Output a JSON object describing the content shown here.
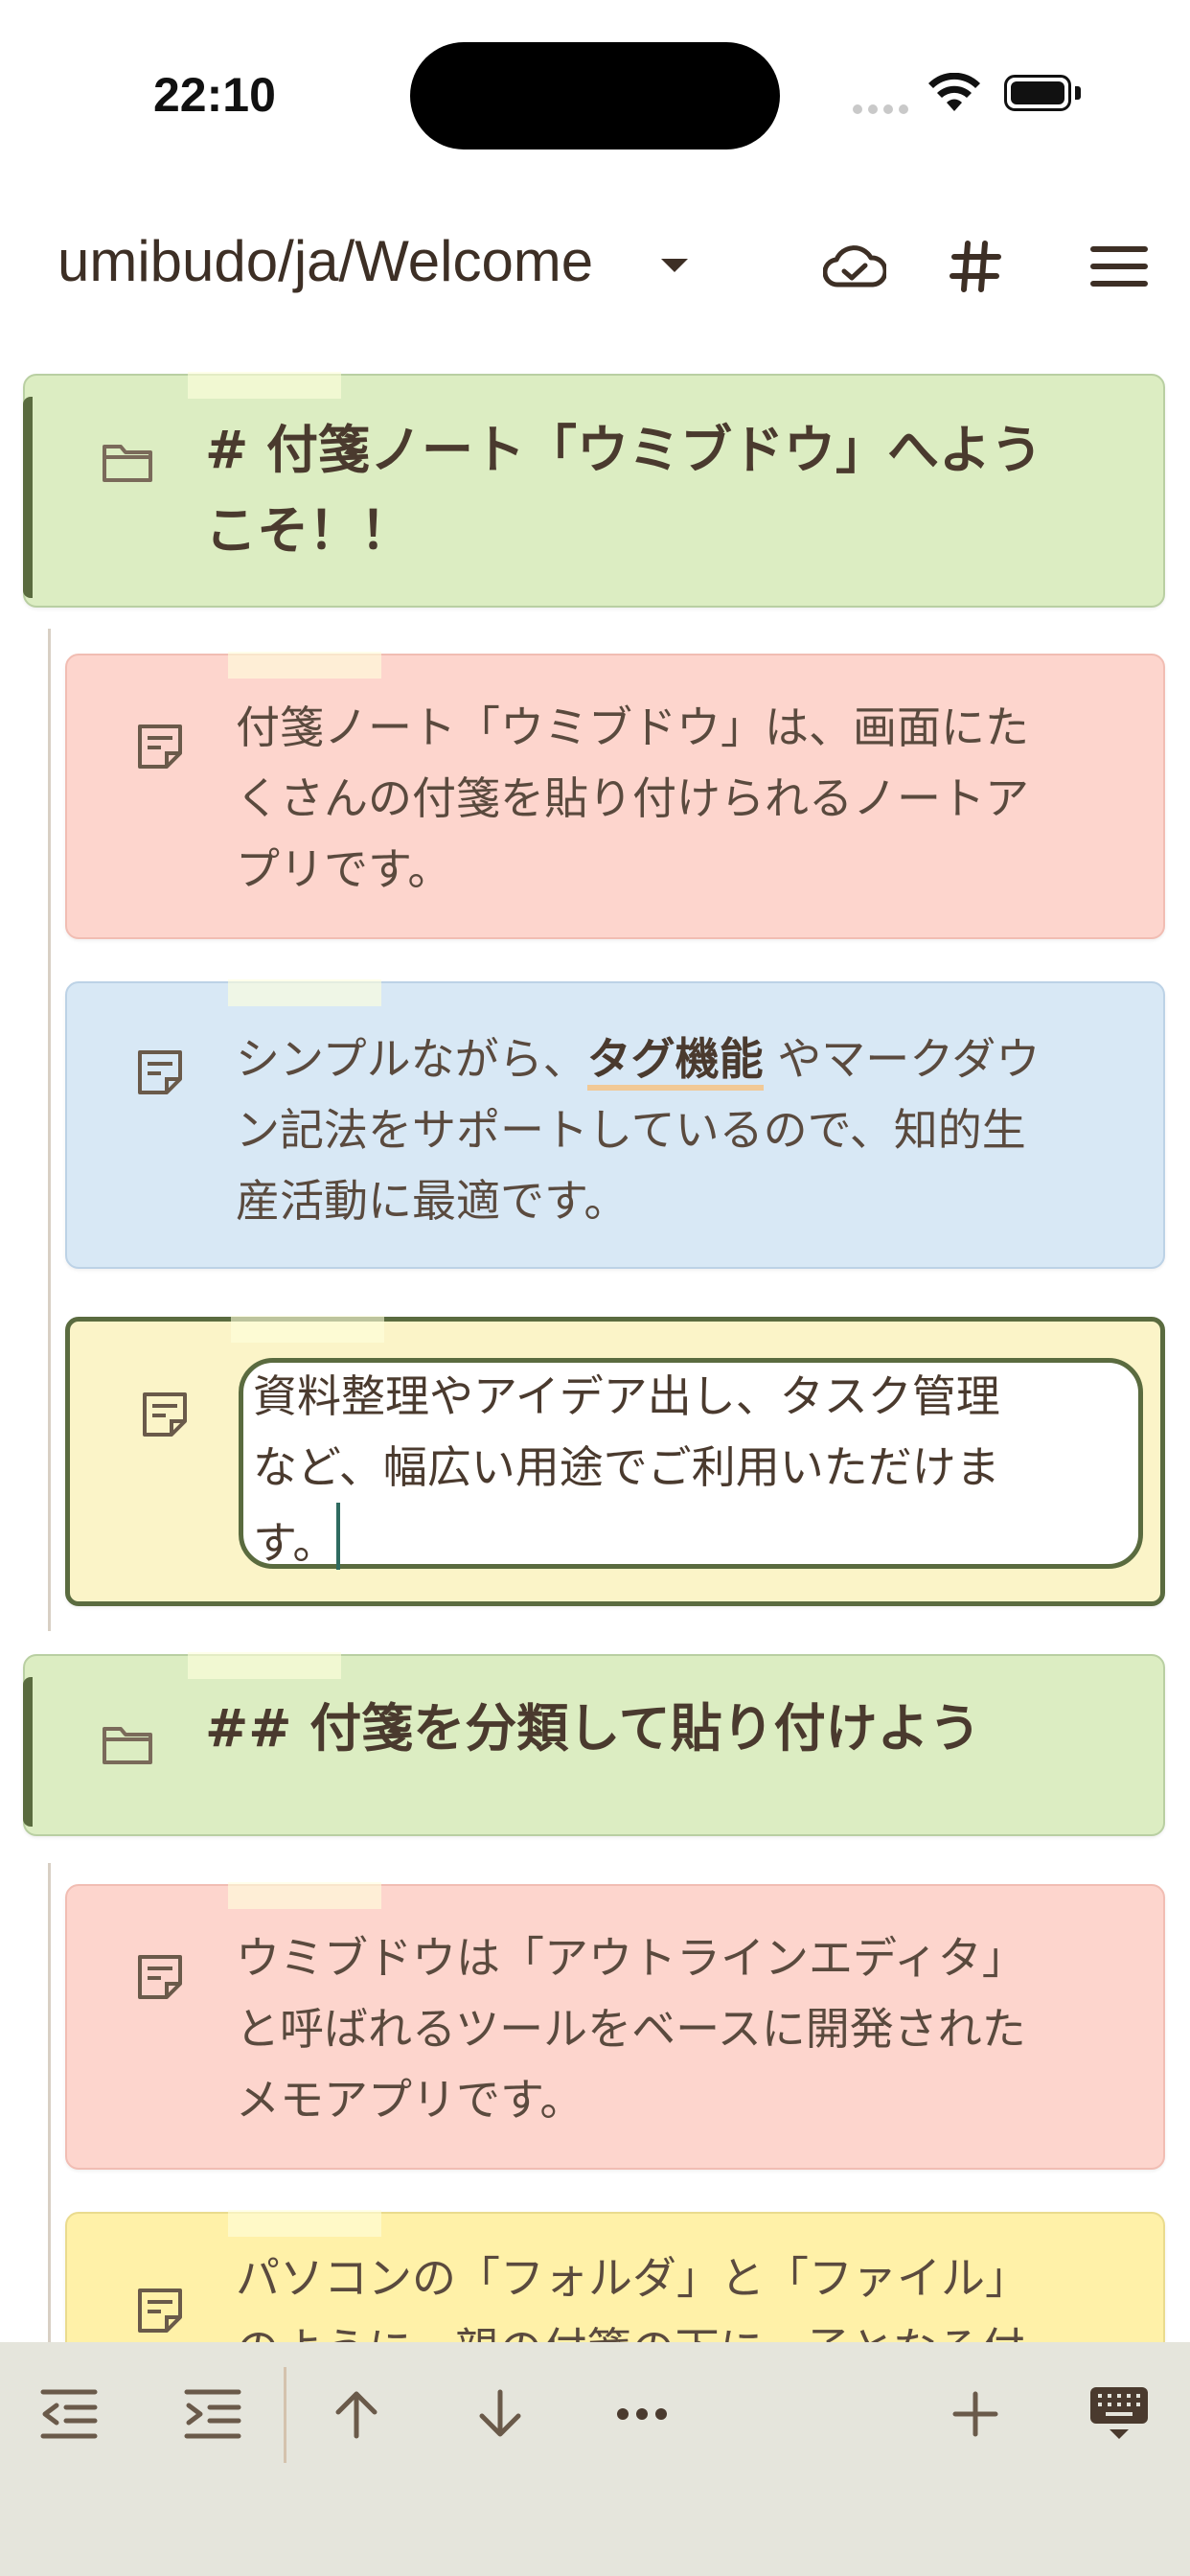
{
  "status_bar": {
    "time": "22:10"
  },
  "header": {
    "title": "umibudo/ja/Welcome"
  },
  "notes": [
    {
      "type": "folder",
      "text": "# 付箋ノート「ウミブドウ」へようこそ！！",
      "lines": [
        "# 付箋ノート「ウミブドウ」へよう",
        "こそ！！"
      ]
    },
    {
      "type": "note",
      "color": "#fdd5cd",
      "lines": [
        "付箋ノート「ウミブドウ」は、画面にた",
        "くさんの付箋を貼り付けられるノートア",
        "プリです。"
      ]
    },
    {
      "type": "note",
      "color": "#d8e8f5",
      "line1_pre": "シンプルながら、",
      "tag": "タグ機能",
      "line1_post": " やマークダウ",
      "lines_rest": [
        "ン記法をサポートしているので、知的生",
        "産活動に最適です。"
      ]
    },
    {
      "type": "note",
      "color": "#fbf4c8",
      "editing": true,
      "lines": [
        "資料整理やアイデア出し、タスク管理",
        "など、幅広い用途でご利用いただけま",
        "す。"
      ]
    },
    {
      "type": "folder",
      "text": "## 付箋を分類して貼り付けよう"
    },
    {
      "type": "note",
      "color": "#fdd5cd",
      "lines": [
        "ウミブドウは「アウトラインエディタ」",
        "と呼ばれるツールをベースに開発された",
        "メモアプリです。"
      ]
    },
    {
      "type": "note",
      "color": "#fff1a8",
      "lines": [
        "パソコンの「フォルダ」と「ファイル」",
        "のように、親の付箋の下に、子となる付"
      ]
    }
  ],
  "icons": {
    "sync": "cloud-check-icon",
    "tags": "hashtag-icon",
    "menu": "hamburger-menu-icon"
  }
}
